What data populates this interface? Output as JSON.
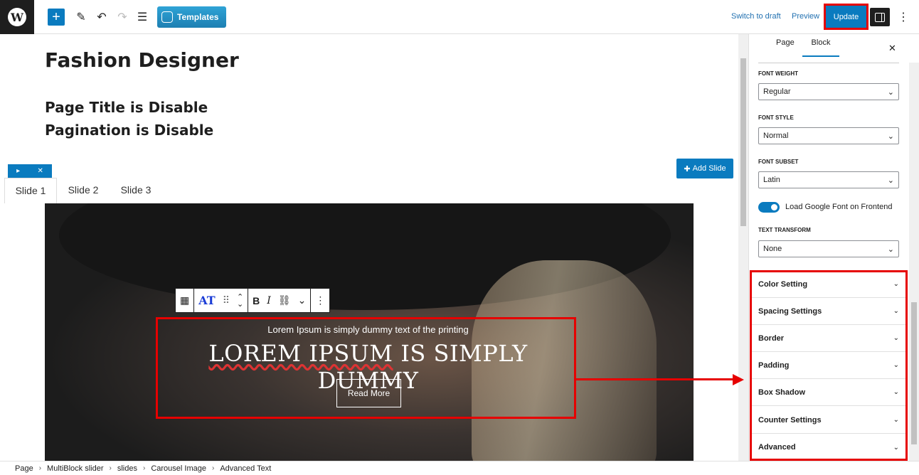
{
  "topbar": {
    "wp_logo": "W",
    "templates_label": "Templates",
    "switch_to_draft": "Switch to draft",
    "preview": "Preview",
    "update": "Update"
  },
  "editor": {
    "page_title": "Fashion Designer",
    "headings": [
      "Page Title is Disable",
      "Pagination is Disable"
    ],
    "add_slide": "Add Slide",
    "slide_tabs": [
      "Slide 1",
      "Slide 2",
      "Slide 3"
    ],
    "slide": {
      "subtitle": "Lorem Ipsum is simply dummy text of the printing",
      "title_part1": "LOREM IPSUM",
      "title_part2": " IS SIMPLY DUMMY",
      "button": "Read More"
    },
    "toolbar": {
      "font_glyph": "AT",
      "bold": "B",
      "italic": "I"
    }
  },
  "sidebar": {
    "tabs": [
      "Page",
      "Block"
    ],
    "active_tab": "Block",
    "fields": [
      {
        "label": "Font Weight",
        "value": "Regular"
      },
      {
        "label": "Font Style",
        "value": "Normal"
      },
      {
        "label": "Font Subset",
        "value": "Latin"
      },
      {
        "label": "Text Transform",
        "value": "None"
      }
    ],
    "toggle_label": "Load Google Font on Frontend",
    "panels": [
      "Color Setting",
      "Spacing Settings",
      "Border",
      "Padding",
      "Box Shadow",
      "Counter Settings",
      "Advanced"
    ]
  },
  "breadcrumb": [
    "Page",
    "MultiBlock slider",
    "slides",
    "Carousel Image",
    "Advanced Text"
  ],
  "colors": {
    "accent": "#0a7bbf",
    "highlight": "#e60000"
  }
}
